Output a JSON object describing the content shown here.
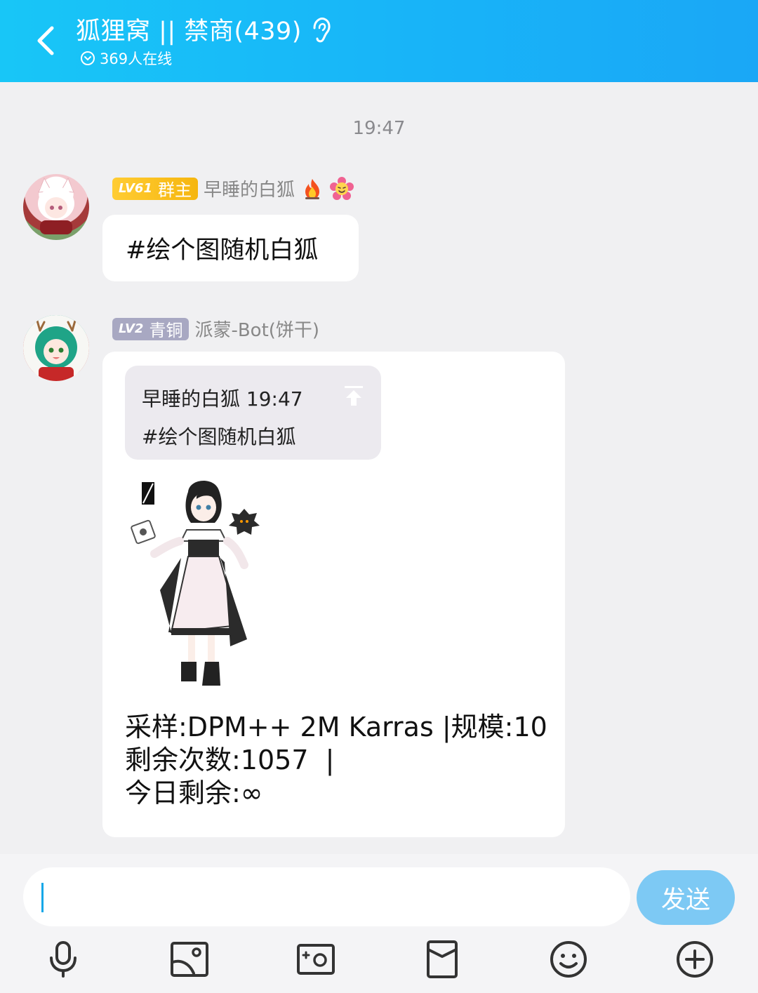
{
  "header": {
    "title": "狐狸窝 || 禁商(439)",
    "online": "369人在线",
    "back_icon": "chevron-left-icon",
    "ear_icon": "ear-icon"
  },
  "chat": {
    "timestamp": "19:47",
    "messages": [
      {
        "level": "LV61",
        "role": "群主",
        "sender": "早睡的白狐",
        "text": "#绘个图随机白狐"
      },
      {
        "level": "LV2",
        "role": "青铜",
        "sender": "派蒙-Bot(饼干)",
        "quote_header": "早睡的白狐 19:47",
        "quote_text": "#绘个图随机白狐",
        "lines": [
          "采样:DPM++ 2M Karras |规模:10",
          "剩余次数:1057  |",
          "今日剩余:∞"
        ]
      }
    ]
  },
  "composer": {
    "input_value": "",
    "send_label": "发送",
    "tools": [
      "microphone-icon",
      "image-icon",
      "camera-icon",
      "red-packet-icon",
      "emoji-icon",
      "plus-icon"
    ]
  },
  "colors": {
    "header": "#18b4f8",
    "send": "#7dc9f4",
    "badge_gold": "#f6b60f",
    "badge_gray": "#a8a8c2"
  }
}
